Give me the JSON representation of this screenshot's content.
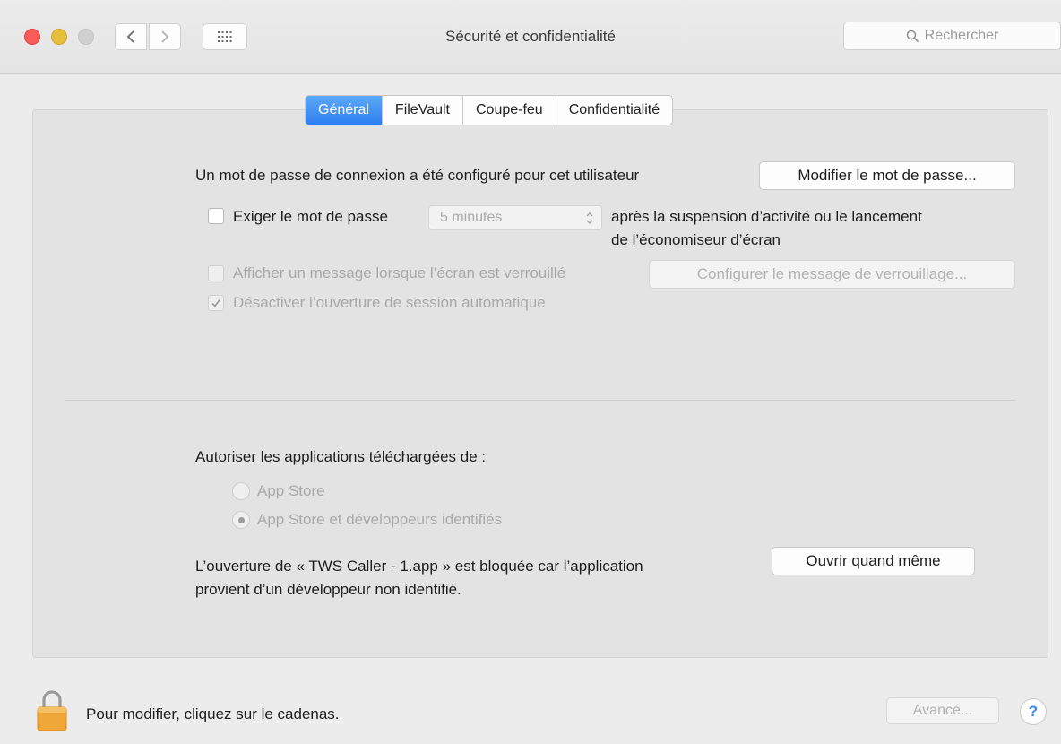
{
  "window": {
    "title": "Sécurité et confidentialité"
  },
  "search": {
    "placeholder": "Rechercher"
  },
  "tabs": [
    {
      "label": "Général",
      "active": true
    },
    {
      "label": "FileVault",
      "active": false
    },
    {
      "label": "Coupe-feu",
      "active": false
    },
    {
      "label": "Confidentialité",
      "active": false
    }
  ],
  "general": {
    "password_notice": "Un mot de passe de connexion a été configuré pour cet utilisateur",
    "change_password_button": "Modifier le mot de passe...",
    "require_password": {
      "label": "Exiger le mot de passe",
      "checked": false,
      "delay_value": "5 minutes",
      "suffix_line1": "après la suspension d’activité ou le lancement",
      "suffix_line2": "de l’économiseur d’écran"
    },
    "lock_message": {
      "label": "Afficher un message lorsque l’écran est verrouillé",
      "checked": false,
      "button": "Configurer le message de verrouillage..."
    },
    "disable_auto_login": {
      "label": "Désactiver l’ouverture de session automatique",
      "checked": true
    }
  },
  "downloads": {
    "heading": "Autoriser les applications téléchargées de :",
    "options": [
      {
        "label": "App Store",
        "selected": false
      },
      {
        "label": "App Store et développeurs identifiés",
        "selected": true
      }
    ],
    "blocked_line1": "L’ouverture de « TWS Caller - 1.app » est bloquée car l’application",
    "blocked_line2": "provient d’un développeur non identifié.",
    "open_anyway_button": "Ouvrir quand même"
  },
  "footer": {
    "lock_text": "Pour modifier, cliquez sur le cadenas.",
    "advanced_button": "Avancé...",
    "help_label": "?"
  },
  "colors": {
    "accent": "#2c7ff1",
    "close": "#fc5b57",
    "minimize": "#e5bf3c",
    "lock": "#f0a73a"
  },
  "icons": [
    "back-chevron-icon",
    "forward-chevron-icon",
    "grid-icon",
    "search-icon",
    "checkmark-icon",
    "stepper-arrows-icon",
    "lock-icon",
    "help-icon"
  ]
}
